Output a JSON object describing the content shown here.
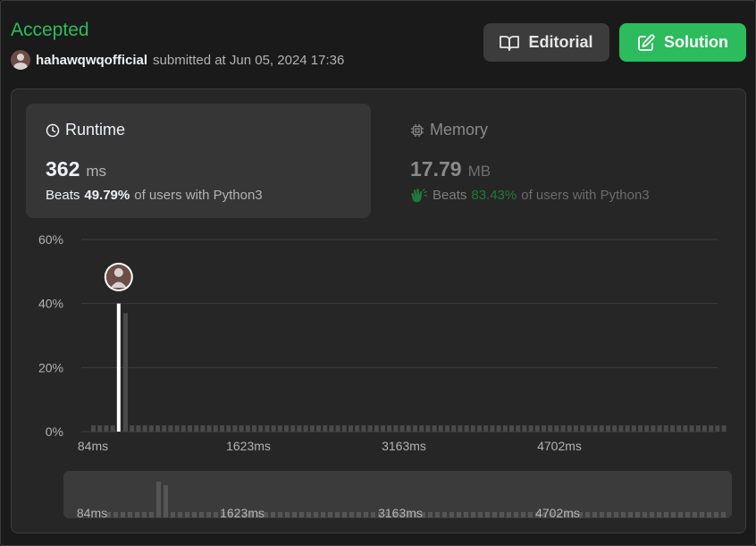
{
  "submission": {
    "status": "Accepted",
    "username": "hahawqwqofficial",
    "submitted_text": "submitted at Jun 05, 2024 17:36"
  },
  "buttons": {
    "editorial_label": "Editorial",
    "solution_label": "Solution"
  },
  "runtime": {
    "title": "Runtime",
    "value": "362",
    "unit": "ms",
    "beats_prefix": "Beats",
    "beats_pct": "49.79%",
    "beats_suffix": "of users with Python3"
  },
  "memory": {
    "title": "Memory",
    "value": "17.79",
    "unit": "MB",
    "beats_prefix": "Beats",
    "beats_pct": "83.43%",
    "beats_suffix": "of users with Python3"
  },
  "colors": {
    "accent_green": "#2cbb5d",
    "selected_bar": "#ffffff",
    "bar": "#4a4a4a",
    "grid": "#3e3e3e"
  },
  "chart_data": {
    "type": "bar",
    "title": "",
    "xlabel": "",
    "ylabel": "",
    "y_tick_labels": [
      "60%",
      "40%",
      "20%",
      "0%"
    ],
    "x_tick_labels": [
      "84ms",
      "1623ms",
      "3163ms",
      "4702ms"
    ],
    "ylim": [
      0,
      60
    ],
    "grid": true,
    "bin_count": 99,
    "selected_bin": 4,
    "selected_value": 40,
    "values": [
      1,
      1,
      1,
      1,
      40,
      37,
      1,
      1,
      1,
      1,
      1,
      1,
      1,
      1,
      1,
      1,
      1,
      1,
      1,
      1,
      1,
      1,
      1,
      1,
      1,
      1,
      1,
      1,
      1,
      1,
      1,
      1,
      1,
      1,
      1,
      1,
      1,
      1,
      1,
      1,
      1,
      1,
      1,
      1,
      1,
      1,
      1,
      1,
      1,
      1,
      1,
      1,
      1,
      1,
      1,
      1,
      1,
      1,
      1,
      1,
      1,
      1,
      1,
      1,
      1,
      1,
      1,
      1,
      1,
      1,
      1,
      1,
      1,
      1,
      1,
      1,
      1,
      1,
      1,
      1,
      1,
      1,
      1,
      1,
      1,
      1,
      1,
      1,
      1,
      1,
      1,
      1,
      1,
      1,
      1,
      1,
      1,
      1,
      1
    ],
    "overview_values": [
      1,
      1,
      1,
      1,
      1,
      1,
      1,
      40,
      36,
      1,
      1,
      1,
      1,
      1,
      1,
      1,
      1,
      1,
      1,
      1,
      1,
      1,
      1,
      1,
      1,
      1,
      1,
      1,
      1,
      1,
      1,
      1,
      1,
      1,
      1,
      1,
      1,
      1,
      1,
      1,
      1,
      1,
      1,
      1,
      1,
      1,
      1,
      1,
      1,
      1,
      1,
      1,
      1,
      1,
      1,
      1,
      1,
      1,
      1,
      1,
      1,
      1,
      1,
      1,
      1,
      1,
      1,
      1,
      1,
      1,
      1,
      1,
      1,
      1,
      1,
      1,
      1,
      1,
      1,
      1,
      1,
      1,
      1,
      1,
      1,
      1,
      1
    ],
    "overview_x_tick_labels": [
      "84ms",
      "1623ms",
      "3163ms",
      "4702ms"
    ]
  }
}
